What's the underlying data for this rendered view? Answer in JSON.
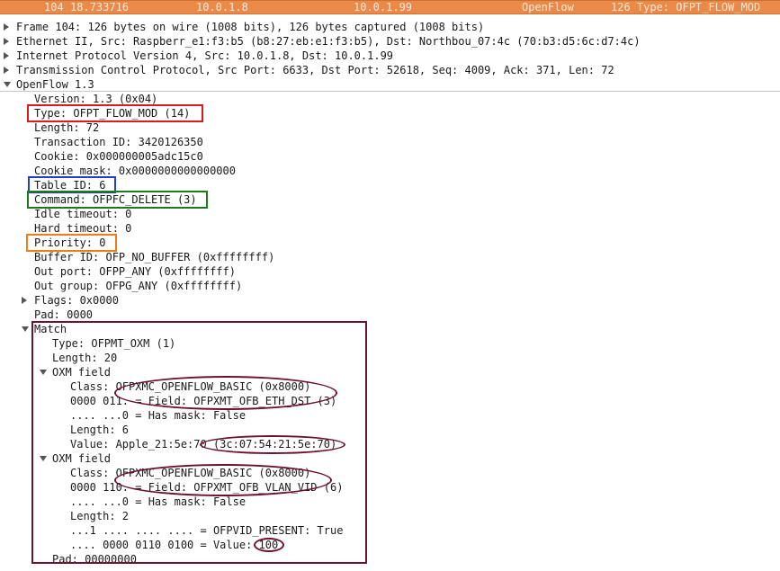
{
  "packet_row": {
    "no": "104",
    "time": "18.733716",
    "source": "10.0.1.8",
    "destination": "10.0.1.99",
    "protocol": "OpenFlow",
    "info": "126 Type: OFPT_FLOW_MOD"
  },
  "tree": {
    "frame": "Frame 104: 126 bytes on wire (1008 bits), 126 bytes captured (1008 bits)",
    "ethernet": "Ethernet II, Src: Raspberr_e1:f3:b5 (b8:27:eb:e1:f3:b5), Dst: Northbou_07:4c (70:b3:d5:6c:d7:4c)",
    "ip": "Internet Protocol Version 4, Src: 10.0.1.8, Dst: 10.0.1.99",
    "tcp": "Transmission Control Protocol, Src Port: 6633, Dst Port: 52618, Seq: 4009, Ack: 371, Len: 72",
    "openflow": "OpenFlow 1.3",
    "of": {
      "version": "Version: 1.3 (0x04)",
      "type": "Type: OFPT_FLOW_MOD (14)",
      "length": "Length: 72",
      "transaction_id": "Transaction ID: 3420126350",
      "cookie": "Cookie: 0x000000005adc15c0",
      "cookie_mask": "Cookie mask: 0x0000000000000000",
      "table_id": "Table ID: 6",
      "command": "Command: OFPFC_DELETE (3)",
      "idle_timeout": "Idle timeout: 0",
      "hard_timeout": "Hard timeout: 0",
      "priority": "Priority: 0",
      "buffer_id": "Buffer ID: OFP_NO_BUFFER (0xffffffff)",
      "out_port": "Out port: OFPP_ANY (0xffffffff)",
      "out_group": "Out group: OFPG_ANY (0xffffffff)",
      "flags": "Flags: 0x0000",
      "pad": "Pad: 0000"
    },
    "match": {
      "label": "Match",
      "type": "Type: OFPMT_OXM (1)",
      "length": "Length: 20",
      "oxm1": {
        "label": "OXM field",
        "class": "Class: OFPXMC_OPENFLOW_BASIC (0x8000)",
        "field": "0000 011. = Field: OFPXMT_OFB_ETH_DST (3)",
        "has_mask": ".... ...0 = Has mask: False",
        "length": "Length: 6",
        "value": "Value: Apple_21:5e:70 (3c:07:54:21:5e:70)"
      },
      "oxm2": {
        "label": "OXM field",
        "class": "Class: OFPXMC_OPENFLOW_BASIC (0x8000)",
        "field": "0000 110. = Field: OFPXMT_OFB_VLAN_VID (6)",
        "has_mask": ".... ...0 = Has mask: False",
        "length": "Length: 2",
        "present": "...1 .... .... .... = OFPVID_PRESENT: True",
        "value": ".... 0000 0110 0100 = Value: 100"
      },
      "pad": "Pad: 00000000"
    }
  },
  "colors": {
    "selected_row": "#ea8a4a",
    "box_type": "#e0191d",
    "box_table": "#1f3fd0",
    "box_command": "#1d7a1d",
    "box_priority": "#f07e10",
    "match_box": "#6e1030"
  }
}
